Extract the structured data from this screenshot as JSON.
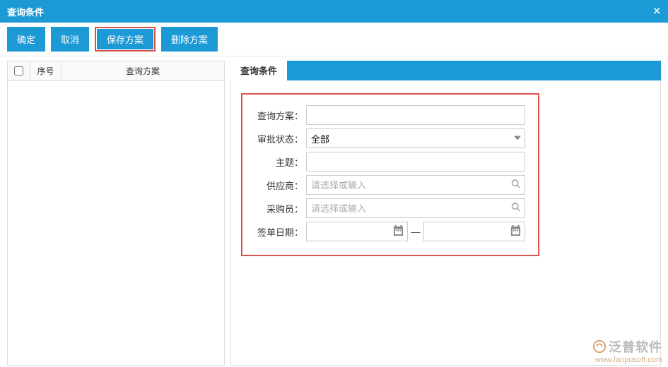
{
  "dialog": {
    "title": "查询条件"
  },
  "toolbar": {
    "ok": "确定",
    "cancel": "取消",
    "save_plan": "保存方案",
    "delete_plan": "删除方案"
  },
  "leftPanel": {
    "col_seq": "序号",
    "col_plan": "查询方案"
  },
  "rightPanel": {
    "tab_title": "查询条件",
    "labels": {
      "plan": "查询方案：",
      "approve": "审批状态：",
      "subject": "主题：",
      "supplier": "供应商：",
      "buyer": "采购员：",
      "sign_date": "签单日期："
    },
    "values": {
      "plan": "",
      "approve": "全部",
      "subject": "",
      "supplier": "",
      "buyer": "",
      "date_from": "",
      "date_to": ""
    },
    "placeholders": {
      "supplier": "请选择或输入",
      "buyer": "请选择或输入"
    },
    "date_sep": "—"
  },
  "watermark": {
    "brand": "泛普软件",
    "url": "www.fanpusoft.com"
  }
}
